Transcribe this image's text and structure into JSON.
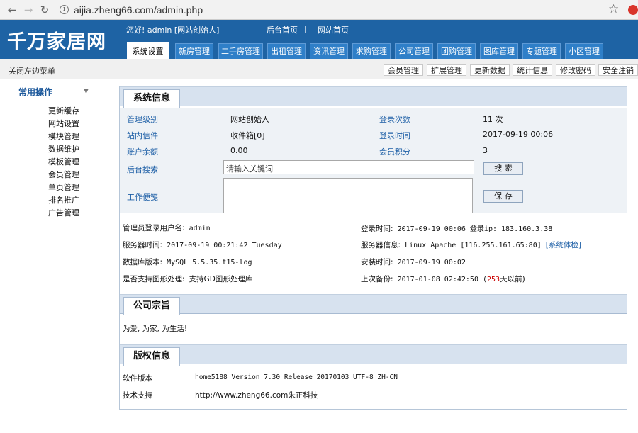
{
  "browser": {
    "back": "←",
    "forward": "→",
    "reload": "↻",
    "info": "i",
    "url": "aijia.zheng66.com/admin.php",
    "star": "☆"
  },
  "header": {
    "logo": "千万家居网",
    "greeting": "您好! admin [网站创始人]",
    "link_admin_home": "后台首页",
    "separator": "|",
    "link_site_home": "网站首页",
    "tabs": [
      "系统设置",
      "新房管理",
      "二手房管理",
      "出租管理",
      "资讯管理",
      "求购管理",
      "公司管理",
      "团购管理",
      "图库管理",
      "专题管理",
      "小区管理"
    ],
    "active_tab": "系统设置"
  },
  "subbar": {
    "close_menu": "关闭左边菜单",
    "buttons": [
      "会员管理",
      "扩展管理",
      "更新数据",
      "统计信息",
      "修改密码",
      "安全注销"
    ]
  },
  "sidebar": {
    "heading": "常用操作",
    "arrow": "▼",
    "items": [
      "更新缓存",
      "网站设置",
      "模块管理",
      "数据维护",
      "模板管理",
      "会员管理",
      "单页管理",
      "排名推广",
      "广告管理"
    ]
  },
  "system_info": {
    "title": "系统信息",
    "admin_level_label": "管理级别",
    "admin_level_value": "网站创始人",
    "login_count_label": "登录次数",
    "login_count_value": "11 次",
    "inbox_label": "站内信件",
    "inbox_value": "收件箱[0]",
    "login_time_label": "登录时间",
    "login_time_value": "2017-09-19 00:06",
    "balance_label": "账户余额",
    "balance_value": "0.00",
    "points_label": "会员积分",
    "points_value": "3",
    "search_label": "后台搜索",
    "search_value": "请输入关键词",
    "search_button": "搜 索",
    "notes_label": "工作便笺",
    "save_button": "保 存",
    "admin_user_label": "管理员登录用户名:",
    "admin_user_value": "admin",
    "login_info_label": "登录时间:",
    "login_info_value": "2017-09-19 00:06 登录ip: 183.160.3.38",
    "server_time_label": "服务器时间:",
    "server_time_value": "2017-09-19 00:21:42 Tuesday",
    "server_info_label": "服务器信息:",
    "server_info_value": "Linux Apache [116.255.161.65:80]",
    "server_check": "[系统体检]",
    "db_label": "数据库版本:",
    "db_value": "MySQL 5.5.35.t15-log",
    "install_label": "安装时间:",
    "install_value": "2017-09-19 00:02",
    "gd_label": "是否支持图形处理:",
    "gd_value": "支持GD图形处理库",
    "backup_label": "上次备份:",
    "backup_value": "2017-01-08 02:42:50 (",
    "backup_days": "253",
    "backup_suffix": "天以前)"
  },
  "mission": {
    "title": "公司宗旨",
    "text": "为爱, 为家, 为生活!"
  },
  "copyright": {
    "title": "版权信息",
    "software_label": "软件版本",
    "software_value": "home5188 Version 7.30 Release 20170103 UTF-8 ZH-CN",
    "support_label": "技术支持",
    "support_link": "http://www.zheng66.com",
    "support_company": "朱正科技"
  },
  "colors": {
    "header_bg": "#1e63a4",
    "tab_bg": "#2f7fc8",
    "section_bg": "#d7e2ef",
    "label_blue": "#1d5fa6",
    "accent_red": "#cc0000"
  }
}
